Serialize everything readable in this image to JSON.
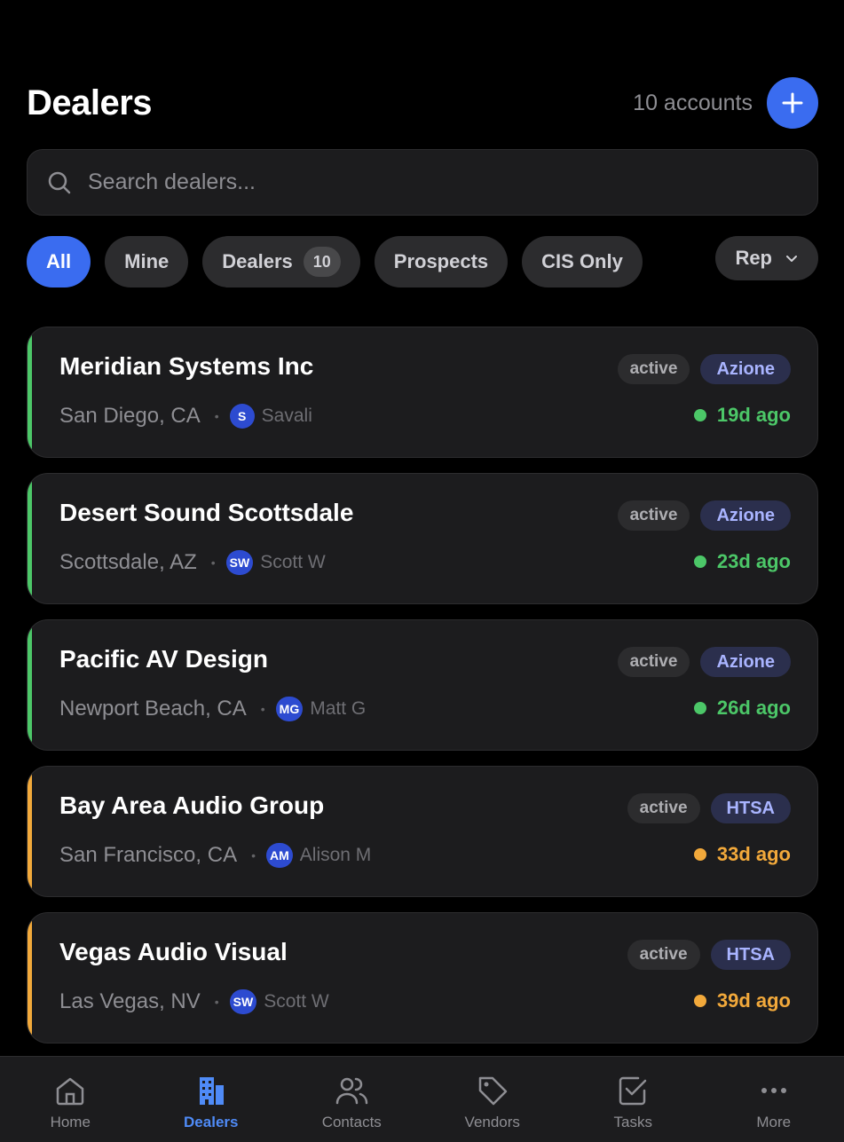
{
  "header": {
    "title": "Dealers",
    "count_text": "10 accounts",
    "add_icon": "plus-icon"
  },
  "search": {
    "placeholder": "Search dealers...",
    "value": ""
  },
  "filters": {
    "chips": [
      {
        "label": "All",
        "active": true
      },
      {
        "label": "Mine"
      },
      {
        "label": "Dealers",
        "badge": "10"
      },
      {
        "label": "Prospects"
      },
      {
        "label": "CIS Only"
      }
    ],
    "rep_label": "Rep"
  },
  "dealers": [
    {
      "name": "Meridian Systems Inc",
      "status": "active",
      "vendor": "Azione",
      "location": "San Diego, CA",
      "rep_initials": "S",
      "rep_name": "Savali",
      "age": "19d ago",
      "accent": "#4cc768"
    },
    {
      "name": "Desert Sound Scottsdale",
      "status": "active",
      "vendor": "Azione",
      "location": "Scottsdale, AZ",
      "rep_initials": "SW",
      "rep_name": "Scott W",
      "age": "23d ago",
      "accent": "#4cc768"
    },
    {
      "name": "Pacific AV Design",
      "status": "active",
      "vendor": "Azione",
      "location": "Newport Beach, CA",
      "rep_initials": "MG",
      "rep_name": "Matt G",
      "age": "26d ago",
      "accent": "#4cc768"
    },
    {
      "name": "Bay Area Audio Group",
      "status": "active",
      "vendor": "HTSA",
      "location": "San Francisco, CA",
      "rep_initials": "AM",
      "rep_name": "Alison M",
      "age": "33d ago",
      "accent": "#f2a93b"
    },
    {
      "name": "Vegas Audio Visual",
      "status": "active",
      "vendor": "HTSA",
      "location": "Las Vegas, NV",
      "rep_initials": "SW",
      "rep_name": "Scott W",
      "age": "39d ago",
      "accent": "#f2a93b"
    }
  ],
  "tabbar": {
    "tabs": [
      {
        "label": "Home",
        "icon": "home-icon"
      },
      {
        "label": "Dealers",
        "icon": "building-icon",
        "active": true
      },
      {
        "label": "Contacts",
        "icon": "users-icon"
      },
      {
        "label": "Vendors",
        "icon": "tag-icon"
      },
      {
        "label": "Tasks",
        "icon": "checkbox-icon"
      },
      {
        "label": "More",
        "icon": "more-icon"
      }
    ]
  },
  "colors": {
    "accent": "#3a6cf0",
    "recent": "#4cc768",
    "stale": "#f2a93b"
  }
}
